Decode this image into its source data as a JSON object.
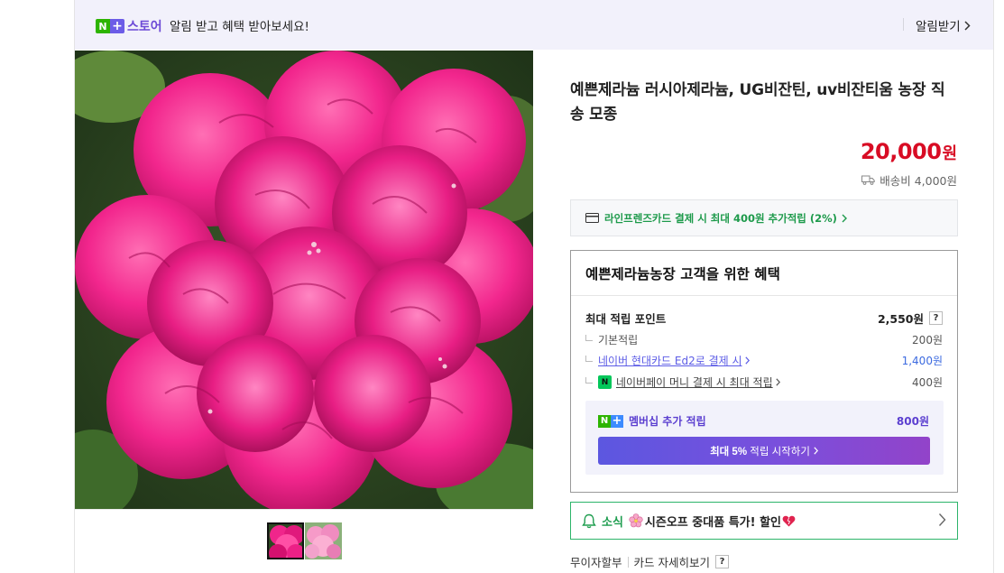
{
  "notice_bar": {
    "logo_n": "N",
    "logo_plus": "+",
    "logo_store": "스토어",
    "message": "알림 받고 혜택 받아보세요!",
    "link_label": "알림받기"
  },
  "gallery": {
    "main_image": "pink-geranium-flowers",
    "thumbnails": [
      "pink-geranium-thumb-1",
      "pink-geranium-thumb-2"
    ],
    "active_thumbnail": 0
  },
  "product": {
    "title": "예쁜제라늄 러시아제라늄, UG비잔틴, uv비잔티움 농장 직송 모종",
    "price": "20,000",
    "price_unit": "원",
    "shipping": "배송비 4,000원"
  },
  "card_promo": {
    "text": "라인프렌즈카드 결제 시 최대 400원 추가적립 (2%)"
  },
  "benefits": {
    "title": "예쁜제라늄농장 고객을 위한 혜택",
    "max_points_label": "최대 적립 포인트",
    "max_points_value": "2,550원",
    "help": "?",
    "rows": [
      {
        "label": "기본적립",
        "value": "200원"
      },
      {
        "label": "네이버 현대카드 Ed2로 결제 시",
        "value": "1,400원"
      },
      {
        "label": "네이버페이 머니 결제 시 최대 적립",
        "value": "400원"
      }
    ],
    "npay_icon": "N",
    "membership": {
      "badge_n": "N",
      "badge_plus": "+",
      "label": "멤버십 추가 적립",
      "value": "800원",
      "button_bold": "최대 5%",
      "button_rest": " 적립 시작하기"
    }
  },
  "news": {
    "label": "소식",
    "text": "시즌오프 중대품 특가! 할인"
  },
  "installment": {
    "label": "무이자할부",
    "card_link": "카드 자세히보기",
    "help": "?"
  },
  "colors": {
    "price_red": "#d80c24",
    "naver_green": "#2db400",
    "membership_purple": "#5b3fd0"
  }
}
